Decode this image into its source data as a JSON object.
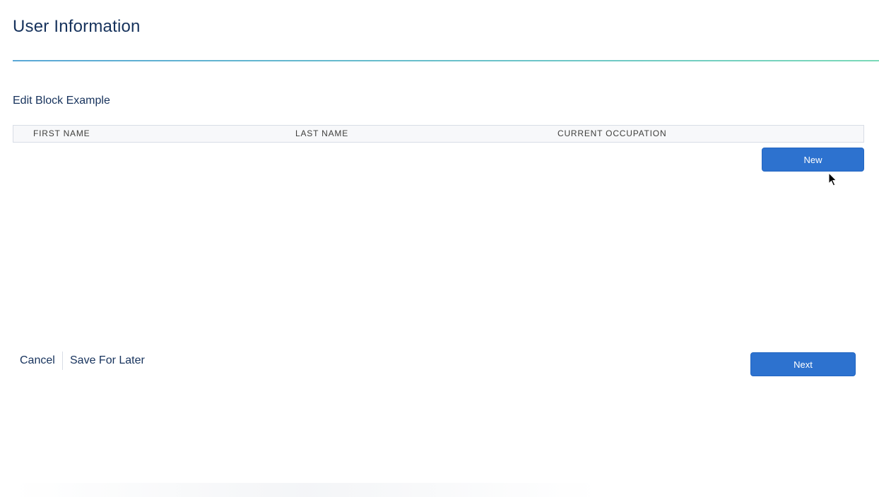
{
  "header": {
    "title": "User Information"
  },
  "edit_block": {
    "heading": "Edit Block Example",
    "columns": [
      "FIRST NAME",
      "LAST NAME",
      "CURRENT OCCUPATION"
    ],
    "rows": [],
    "new_label": "New"
  },
  "footer": {
    "cancel_label": "Cancel",
    "save_label": "Save For Later",
    "next_label": "Next"
  },
  "colors": {
    "title_text": "#16325c",
    "brand_button": "#2d72cf",
    "rule_start": "#5aa8d6",
    "rule_end": "#7ad9b8"
  },
  "icons": {
    "cursor": "mouse-pointer-icon"
  }
}
